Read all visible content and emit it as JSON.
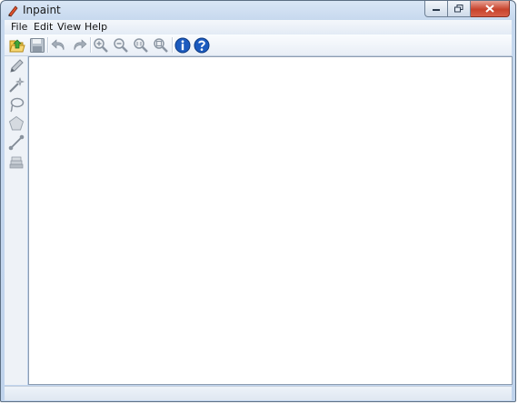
{
  "window": {
    "title": "Inpaint"
  },
  "menubar": {
    "items": [
      "File",
      "Edit",
      "View",
      "Help"
    ]
  },
  "toolbar": {
    "icons": [
      "open-icon",
      "save-icon",
      "undo-icon",
      "redo-icon",
      "zoom-in-icon",
      "zoom-out-icon",
      "zoom-actual-size-icon",
      "zoom-fit-icon",
      "info-icon",
      "help-icon"
    ]
  },
  "sidebar": {
    "tools": [
      "pencil-icon",
      "magic-wand-icon",
      "lasso-icon",
      "polygon-icon",
      "line-icon",
      "eraser-icon"
    ]
  },
  "colors": {
    "title_bar": "#c6d8ee",
    "canvas": "#ffffff",
    "close_button": "#c7432c",
    "info_blue": "#1c5bbf"
  }
}
